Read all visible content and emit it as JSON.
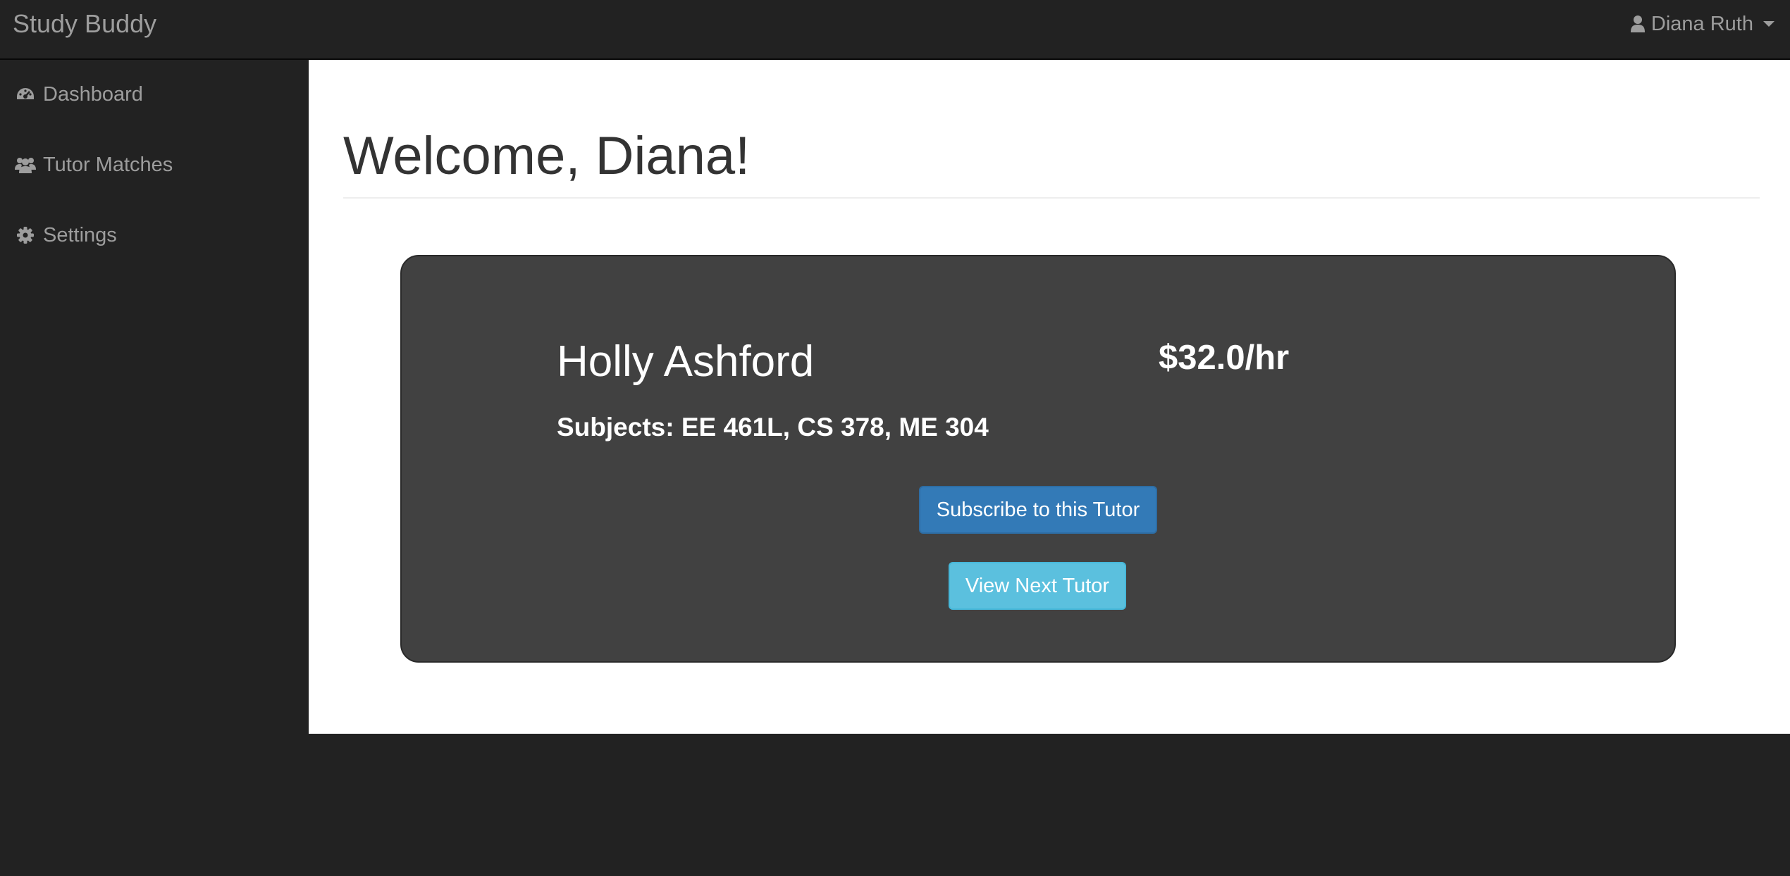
{
  "navbar": {
    "brand": "Study Buddy",
    "user_name": "Diana Ruth",
    "user_icon": "user-icon"
  },
  "sidebar": {
    "items": [
      {
        "label": "Dashboard",
        "icon": "dashboard-icon"
      },
      {
        "label": "Tutor Matches",
        "icon": "users-icon"
      },
      {
        "label": "Settings",
        "icon": "gear-icon"
      }
    ]
  },
  "main": {
    "title": "Welcome, Diana!",
    "tutor": {
      "name": "Holly Ashford",
      "rate": "$32.0/hr",
      "subjects": "Subjects: EE 461L, CS 378, ME 304",
      "subscribe_label": "Subscribe to this Tutor",
      "next_label": "View Next Tutor"
    }
  },
  "colors": {
    "navbar_bg": "#222222",
    "nav_text": "#9d9d9d",
    "card_bg": "#414141",
    "primary": "#337ab7",
    "info": "#5bc0de"
  }
}
